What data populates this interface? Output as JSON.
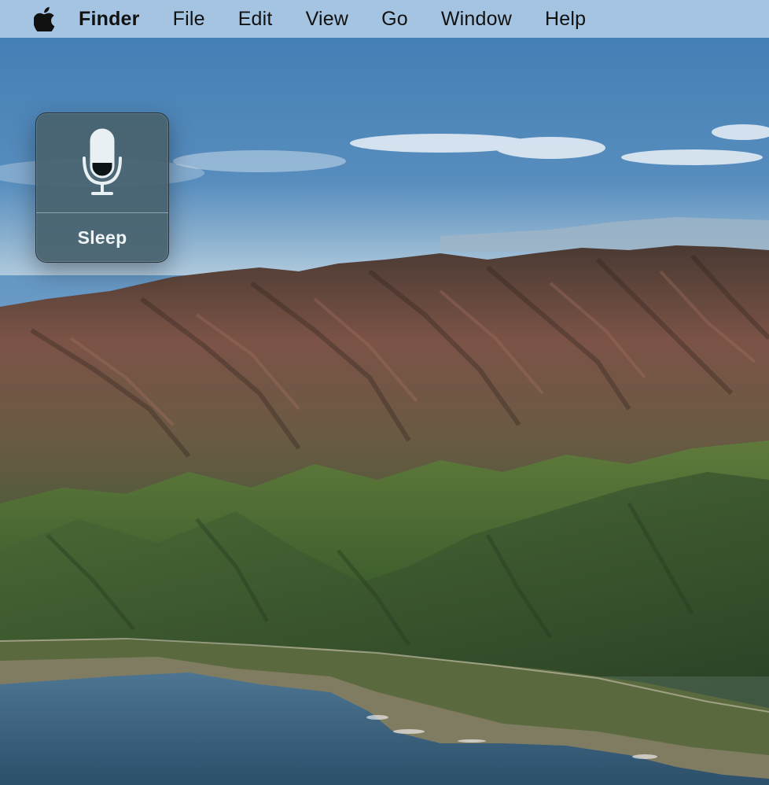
{
  "menubar": {
    "apple_icon": "apple-logo-icon",
    "app_name": "Finder",
    "items": [
      {
        "label": "File"
      },
      {
        "label": "Edit"
      },
      {
        "label": "View"
      },
      {
        "label": "Go"
      },
      {
        "label": "Window"
      },
      {
        "label": "Help"
      }
    ]
  },
  "dictation": {
    "icon": "microphone-icon",
    "status": "Sleep",
    "level": 0.3
  },
  "colors": {
    "menubar_bg": "#b2cee8",
    "hud_bg": "#48626e",
    "hud_text": "#eef3f5",
    "sky": "#6f9fc8",
    "ocean": "#3e6583"
  }
}
